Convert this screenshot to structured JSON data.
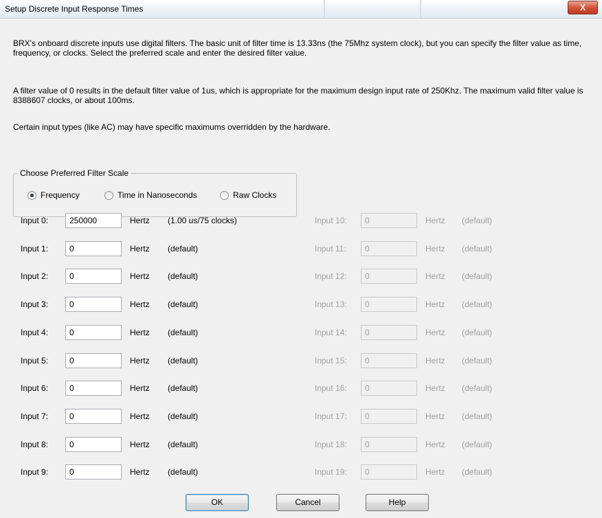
{
  "window": {
    "title": "Setup Discrete Input Response Times",
    "close_glyph": "X"
  },
  "text": {
    "para1": "BRX's onboard discrete inputs use digital filters. The basic unit of filter time is 13.33ns (the 75Mhz system clock), but you can specify the filter value as time, frequency, or clocks. Select the preferred scale and enter the desired filter value.",
    "para2": "A filter value of 0 results in the default filter value of 1us, which is appropriate for the maximum design input rate of 250Khz. The maximum valid filter value is 8388607 clocks, or about 100ms.",
    "para3": "Certain input types (like AC) may have specific maximums overridden by the hardware."
  },
  "scale_group": {
    "legend": "Choose Preferred Filter Scale",
    "options": [
      {
        "label": "Frequency",
        "selected": true
      },
      {
        "label": "Time in Nanoseconds",
        "selected": false
      },
      {
        "label": "Raw Clocks",
        "selected": false
      }
    ]
  },
  "inputs_left": [
    {
      "label": "Input 0:",
      "value": "250000",
      "unit": "Hertz",
      "note": "(1.00 us/75 clocks)"
    },
    {
      "label": "Input 1:",
      "value": "0",
      "unit": "Hertz",
      "note": "(default)"
    },
    {
      "label": "Input 2:",
      "value": "0",
      "unit": "Hertz",
      "note": "(default)"
    },
    {
      "label": "Input 3:",
      "value": "0",
      "unit": "Hertz",
      "note": "(default)"
    },
    {
      "label": "Input 4:",
      "value": "0",
      "unit": "Hertz",
      "note": "(default)"
    },
    {
      "label": "Input 5:",
      "value": "0",
      "unit": "Hertz",
      "note": "(default)"
    },
    {
      "label": "Input 6:",
      "value": "0",
      "unit": "Hertz",
      "note": "(default)"
    },
    {
      "label": "Input 7:",
      "value": "0",
      "unit": "Hertz",
      "note": "(default)"
    },
    {
      "label": "Input 8:",
      "value": "0",
      "unit": "Hertz",
      "note": "(default)"
    },
    {
      "label": "Input 9:",
      "value": "0",
      "unit": "Hertz",
      "note": "(default)"
    }
  ],
  "inputs_right": [
    {
      "label": "Input 10:",
      "value": "0",
      "unit": "Hertz",
      "note": "(default)"
    },
    {
      "label": "Input 11:",
      "value": "0",
      "unit": "Hertz",
      "note": "(default)"
    },
    {
      "label": "Input 12:",
      "value": "0",
      "unit": "Hertz",
      "note": "(default)"
    },
    {
      "label": "Input 13:",
      "value": "0",
      "unit": "Hertz",
      "note": "(default)"
    },
    {
      "label": "Input 14:",
      "value": "0",
      "unit": "Hertz",
      "note": "(default)"
    },
    {
      "label": "Input 15:",
      "value": "0",
      "unit": "Hertz",
      "note": "(default)"
    },
    {
      "label": "Input 16:",
      "value": "0",
      "unit": "Hertz",
      "note": "(default)"
    },
    {
      "label": "Input 17:",
      "value": "0",
      "unit": "Hertz",
      "note": "(default)"
    },
    {
      "label": "Input 18:",
      "value": "0",
      "unit": "Hertz",
      "note": "(default)"
    },
    {
      "label": "Input 19:",
      "value": "0",
      "unit": "Hertz",
      "note": "(default)"
    }
  ],
  "buttons": {
    "ok": "OK",
    "cancel": "Cancel",
    "help": "Help"
  }
}
